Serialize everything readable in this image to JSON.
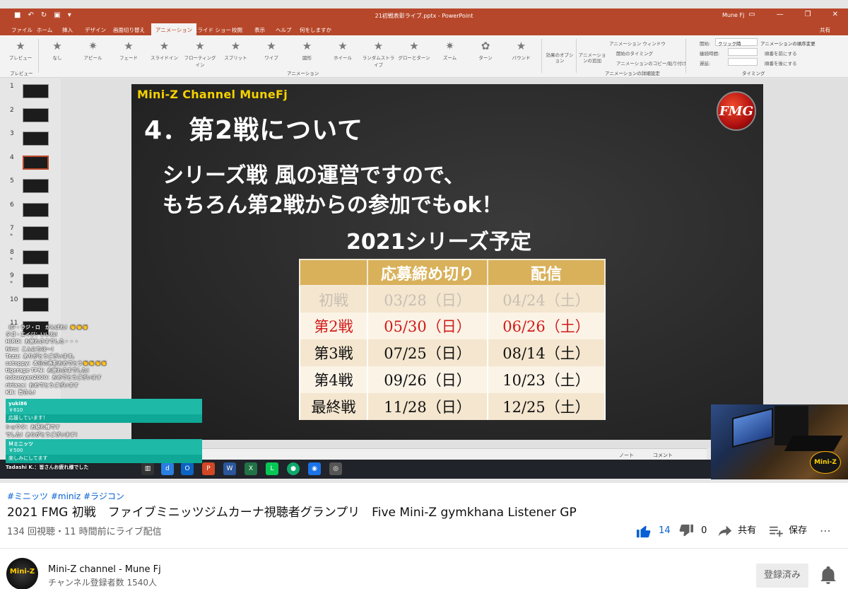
{
  "ppt": {
    "window_title": "21初戦表彰ライブ.pptx - PowerPoint",
    "user": "Mune Fj",
    "share_label": "共有",
    "tabs": [
      "ファイル",
      "ホーム",
      "挿入",
      "デザイン",
      "画面切り替え",
      "アニメーション",
      "スライド ショー",
      "校閲",
      "表示",
      "ヘルプ",
      "何をしますか"
    ],
    "active_tab": "アニメーション",
    "preview_label": "プレビュー",
    "animations": [
      "なし",
      "アピール",
      "フェード",
      "スライドイン",
      "フローティングイン",
      "スプリット",
      "ワイプ",
      "図形",
      "ホイール",
      "ランダムストライプ",
      "グローとターン",
      "ズーム",
      "ターン",
      "バウンド"
    ],
    "effect_options": "効果のオプション",
    "add_animation": "アニメーションの追加",
    "anim_window": "アニメーション ウィンドウ",
    "trigger": "開始のタイミング",
    "anim_painter": "アニメーションのコピー/貼り付け",
    "start_label": "開始:",
    "start_value": "クリック時",
    "duration_label": "継続時間:",
    "delay_label": "遅延:",
    "reorder_title": "アニメーションの順序変更",
    "move_earlier": "順番を前にする",
    "move_later": "順番を後にする",
    "group_preview": "プレビュー",
    "group_animation": "アニメーション",
    "group_advanced": "アニメーションの詳細設定",
    "group_timing": "タイミング",
    "slide_numbers": [
      "1",
      "2",
      "3",
      "4",
      "5",
      "6",
      "7",
      "8",
      "9",
      "10",
      "11"
    ],
    "starred": [
      "",
      "",
      "",
      "",
      "",
      "",
      "*",
      "*",
      "*",
      "",
      ""
    ],
    "notes_label": "ノート",
    "comments_label": "コメント"
  },
  "slide": {
    "channel": "Mini-Z Channel MuneFj",
    "logo_text": "FMG",
    "heading": "4．第2戦について",
    "line1": "シリーズ戦 風の運営ですので、",
    "line2": "もちろん第2戦からの参加でもok！",
    "schedule_title": "2021シリーズ予定",
    "table": {
      "headers": [
        "",
        "応募締め切り",
        "配信"
      ],
      "rows": [
        [
          "初戦",
          "03/28（日）",
          "04/24（土）"
        ],
        [
          "第2戦",
          "05/30（日）",
          "06/26（土）"
        ],
        [
          "第3戦",
          "07/25（日）",
          "08/14（土）"
        ],
        [
          "第4戦",
          "09/26（日）",
          "10/23（土）"
        ],
        [
          "最終戦",
          "11/28（日）",
          "12/25（土）"
        ]
      ]
    }
  },
  "chat": {
    "lines": [
      "（ジ・ラジ・ロ　がんばれ！👏👏👏",
      "タゴ・エイジ：いいね！",
      "HIRO：お疲れさまでした・・・",
      "hiro：こんにちは〜！",
      "Tezu：ありがとうございます。",
      "satoppy：本日の表彰おめでとう👏👏👏👏",
      "tigerage TPN：お疲れさまでした！",
      "nobunyan2000：おめでとうございます",
      "ririana：おめでとうございます",
      "KB：皆さん！"
    ],
    "superchat1": {
      "name": "yuki86",
      "amount": "￥610",
      "message": "応援しています！"
    },
    "middle_lines": [
      "ショウタ：お疲れ様です",
      "でした！ありがとうございます！"
    ],
    "superchat2": {
      "name": "Ｍミニッツ",
      "amount": "￥500",
      "message": "楽しみにしてます"
    },
    "bottom_line": "Tadashi K.：皆さんお疲れ様でした"
  },
  "cam": {
    "logo_text": "Mini-Z"
  },
  "video": {
    "tags": "#ミニッツ #miniz #ラジコン",
    "title": "2021 FMG 初戦　ファイブミニッツジムカーナ視聴者グランプリ　Five Mini-Z gymkhana Listener GP",
    "meta": "134 回視聴・11 時間前にライブ配信",
    "likes": "14",
    "dislikes": "0",
    "share": "共有",
    "save": "保存"
  },
  "channel": {
    "name": "Mini-Z channel - Mune Fj",
    "subscribers": "チャンネル登録者数 1540人",
    "subscribe_button": "登録済み",
    "avatar_text": "Mini-Z"
  }
}
